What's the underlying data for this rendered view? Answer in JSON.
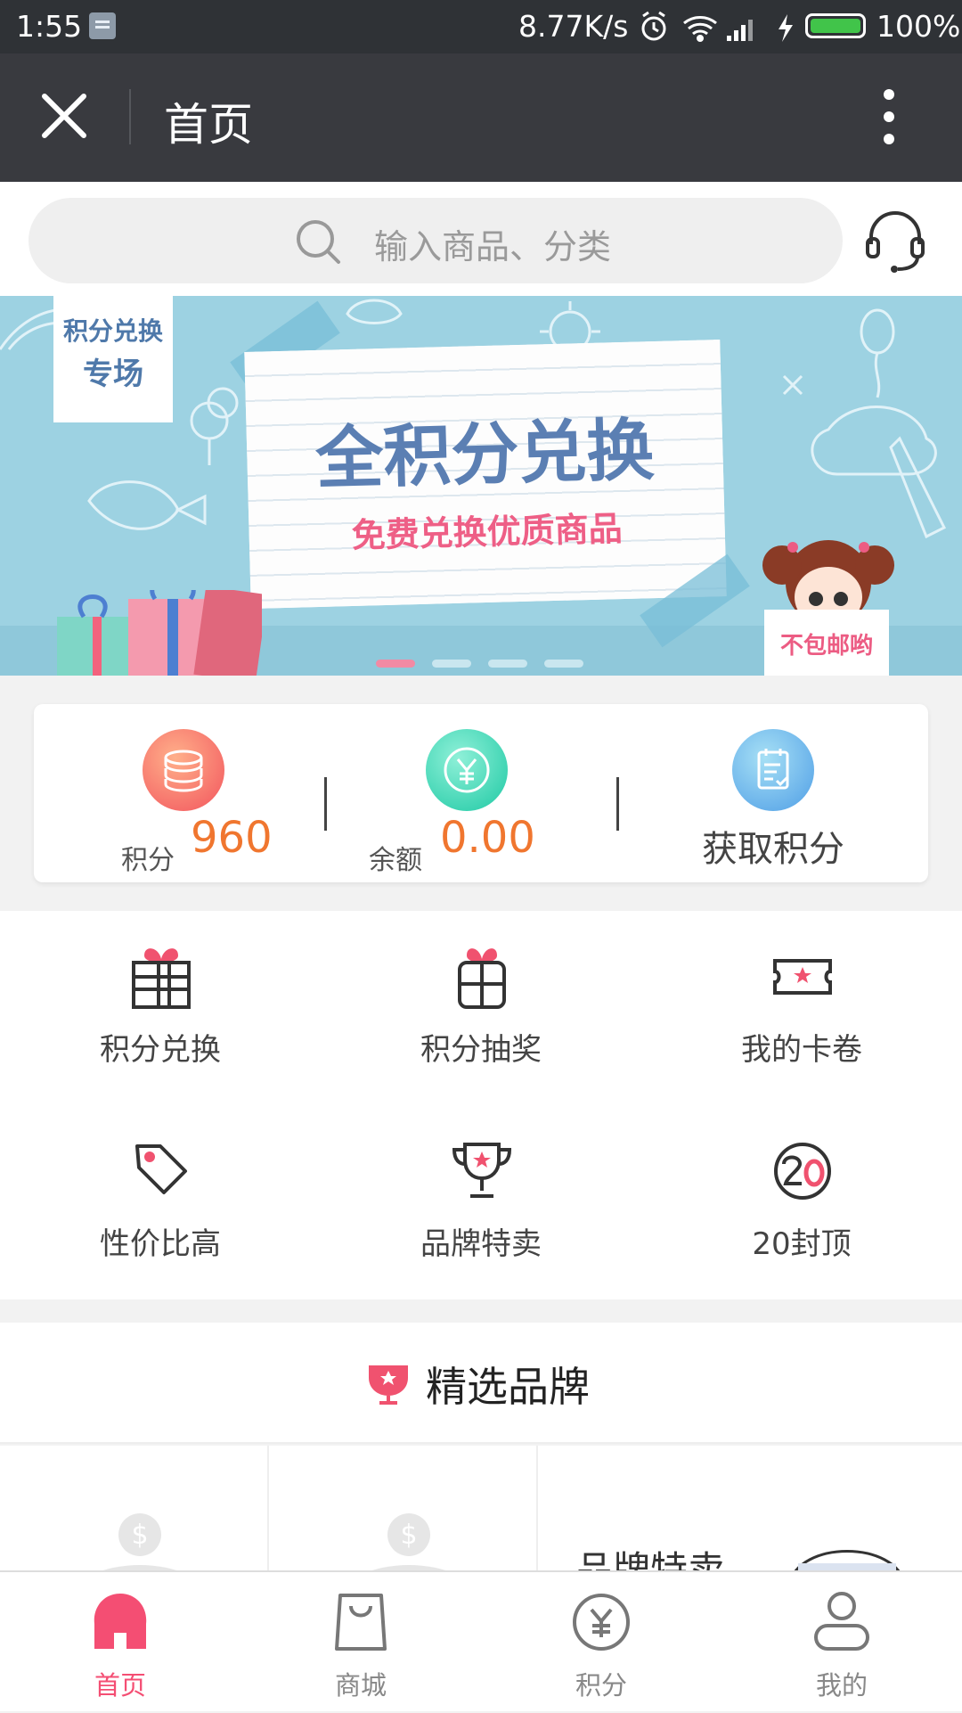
{
  "status_bar": {
    "time": "1:55",
    "speed": "8.77K/s",
    "battery": "100%"
  },
  "nav": {
    "title": "首页"
  },
  "search": {
    "placeholder": "输入商品、分类"
  },
  "banner": {
    "tag_line1": "积分兑换",
    "tag_line2": "专场",
    "headline": "全积分兑换",
    "subline": "免费兑换优质商品",
    "sign": "不包邮哟",
    "active_index": 0,
    "slide_count": 4
  },
  "stats": {
    "points_label": "积分",
    "points_value": "960",
    "balance_label": "余额",
    "balance_value": "0.00",
    "earn_label": "获取积分"
  },
  "menu": [
    {
      "label": "积分兑换",
      "icon": "gift-box-icon"
    },
    {
      "label": "积分抽奖",
      "icon": "gift-draw-icon"
    },
    {
      "label": "我的卡卷",
      "icon": "ticket-icon"
    },
    {
      "label": "性价比高",
      "icon": "price-tag-icon"
    },
    {
      "label": "品牌特卖",
      "icon": "trophy-icon"
    },
    {
      "label": "20封顶",
      "icon": "twenty-cap-icon"
    }
  ],
  "brands": {
    "title": "精选品牌",
    "cell3_text": "品牌特卖"
  },
  "tabs": [
    {
      "label": "首页",
      "icon": "home-icon",
      "active": true
    },
    {
      "label": "商城",
      "icon": "shopping-bag-icon",
      "active": false
    },
    {
      "label": "积分",
      "icon": "points-coin-icon",
      "active": false
    },
    {
      "label": "我的",
      "icon": "user-icon",
      "active": false
    }
  ],
  "colors": {
    "accent": "#f44e73",
    "value_orange": "#f0762f",
    "nav_bg": "#393a3f",
    "status_bg": "#2f3236"
  }
}
